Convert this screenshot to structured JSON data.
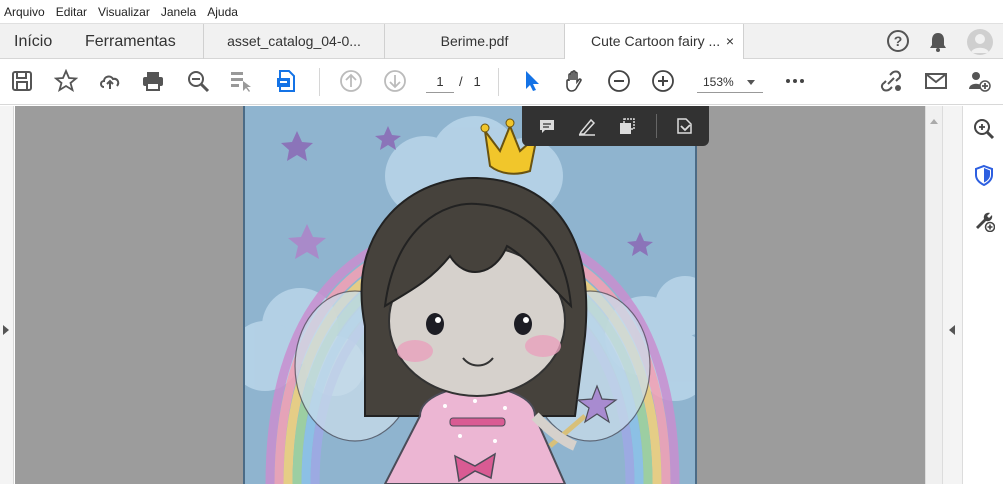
{
  "menu": [
    "Arquivo",
    "Editar",
    "Visualizar",
    "Janela",
    "Ajuda"
  ],
  "tabs": {
    "home": "Início",
    "tools": "Ferramentas",
    "documents": [
      {
        "label": "asset_catalog_04-0..."
      },
      {
        "label": "Berime.pdf"
      },
      {
        "label": "Cute Cartoon fairy ...",
        "active": true,
        "close": "×"
      }
    ]
  },
  "header_icons": [
    "help-icon",
    "notifications-icon",
    "account-avatar"
  ],
  "help_glyph": "?",
  "toolbar": {
    "icons_left": [
      "save-icon",
      "bookmark-star-icon",
      "cloud-upload-icon",
      "print-icon",
      "search-zoom-icon",
      "redact-pointer-icon",
      "export-pdf-icon"
    ],
    "page_current": "1",
    "page_separator": "/",
    "page_total": "1",
    "zoom": "153%",
    "icons_right": [
      "link-share-icon",
      "email-icon",
      "add-user-icon"
    ]
  },
  "floating_toolbar": [
    "comment-icon",
    "highlight-pen-icon",
    "text-select-icon",
    "stamp-icon"
  ],
  "right_panel": [
    "zoom-search-icon",
    "protect-shield-icon",
    "tools-add-icon"
  ],
  "colors": {
    "accent": "#1473e6",
    "page_bg": "#8fb4cf",
    "canvas_bg": "#9c9c9c",
    "floatbar_bg": "#323232"
  }
}
